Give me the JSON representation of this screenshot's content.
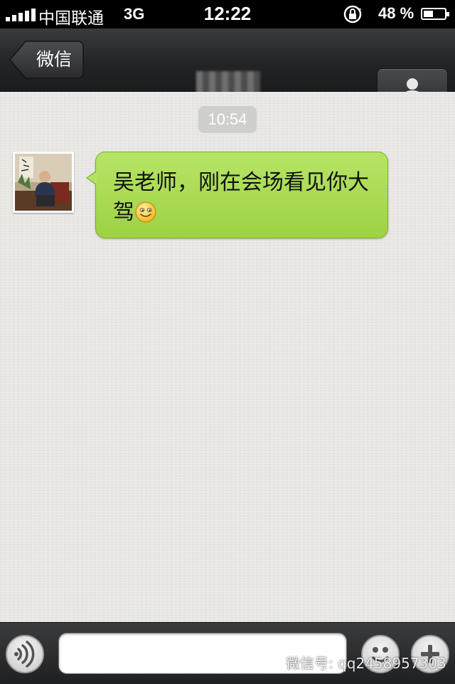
{
  "status_bar": {
    "carrier": "中国联通",
    "network": "3G",
    "time": "12:22",
    "battery_percent": "48 %",
    "battery_level": 0.48,
    "icons": [
      "signal-icon",
      "rotation-lock-icon",
      "battery-icon"
    ]
  },
  "nav": {
    "back_label": "微信",
    "title": "",
    "contact_icon": "person-icon"
  },
  "chat": {
    "timestamp": "10:54",
    "messages": [
      {
        "sender": "other",
        "text": "吴老师，刚在会场看见你大驾",
        "emoji": "smiley-icon"
      }
    ]
  },
  "input_bar": {
    "voice_icon": "voice-icon",
    "emoji_icon": "emoji-icon",
    "plus_icon": "plus-icon",
    "text_value": ""
  },
  "watermark": {
    "text": "微信号: qq2458957303",
    "icon": "wechat-logo-icon"
  },
  "colors": {
    "bubble": "#a8dc55",
    "navbar": "#2a2b2d",
    "status_bar": "#000000",
    "background": "#ecebe8"
  }
}
